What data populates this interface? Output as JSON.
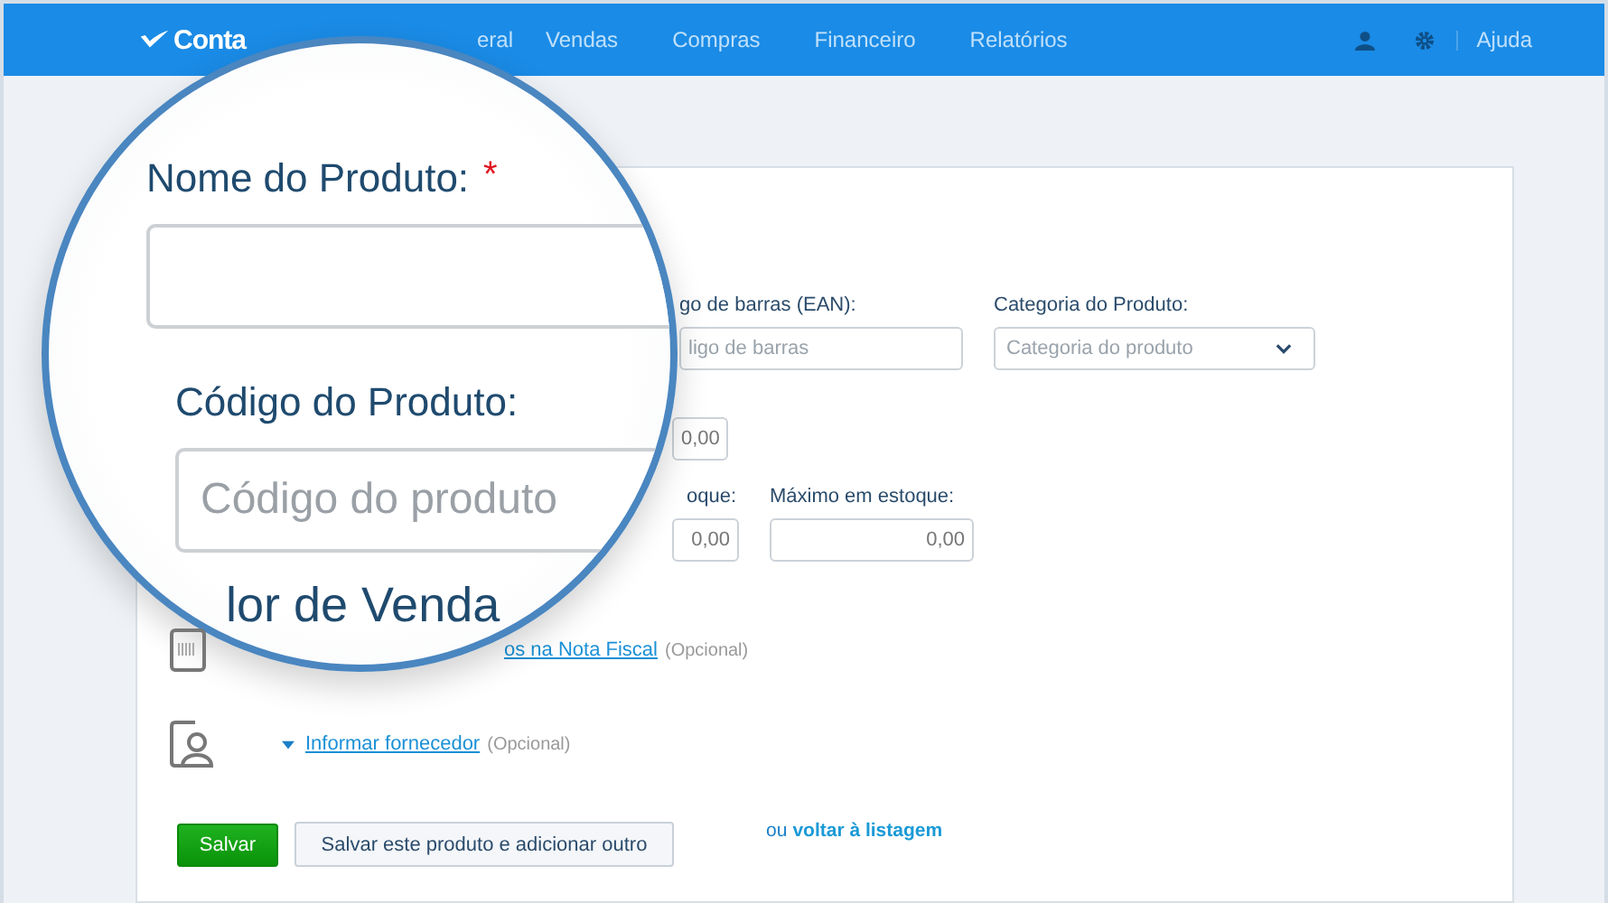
{
  "header": {
    "logo": "Conta",
    "nav": [
      {
        "label": "eral"
      },
      {
        "label": "Vendas"
      },
      {
        "label": "Compras"
      },
      {
        "label": "Financeiro"
      },
      {
        "label": "Relatórios"
      }
    ],
    "help": "Ajuda"
  },
  "magnifier": {
    "name_label": "Nome do Produto:",
    "required_mark": "*",
    "code_label": "Código do Produto:",
    "code_placeholder": "Código do produto",
    "section_text": "lor de Venda"
  },
  "form": {
    "barcode": {
      "label": "go de barras (EAN):",
      "placeholder": "ligo de barras"
    },
    "category": {
      "label": "Categoria do Produto:",
      "placeholder": "Categoria do produto"
    },
    "price": {
      "value": "0,00"
    },
    "min_stock": {
      "label": "oque:",
      "value": "0,00"
    },
    "max_stock": {
      "label": "Máximo em estoque:",
      "value": "0,00"
    }
  },
  "options": [
    {
      "kind": "barcode",
      "expander": false,
      "link": "os na Nota Fiscal",
      "note": "(Opcional)"
    },
    {
      "kind": "supplier",
      "expander": true,
      "link": "Informar fornecedor",
      "note": "(Opcional)"
    }
  ],
  "actions": {
    "save": "Salvar",
    "save_add": "Salvar este produto e adicionar outro",
    "or": "ou",
    "back": "voltar à listagem"
  }
}
